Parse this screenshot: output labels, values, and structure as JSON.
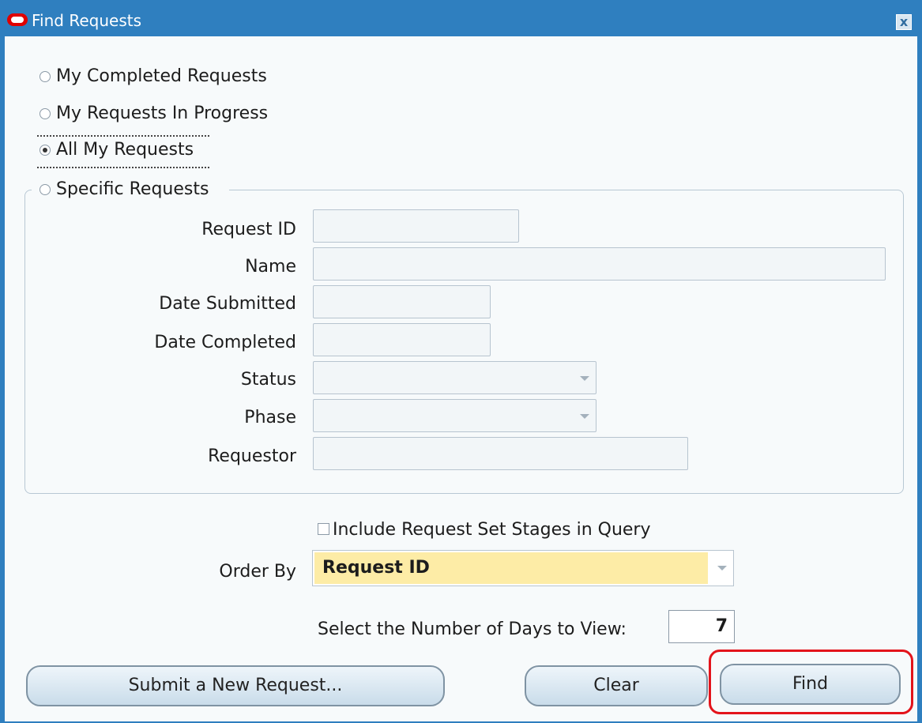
{
  "window": {
    "title": "Find Requests",
    "close_label": "x"
  },
  "request_scope": {
    "options": [
      {
        "label": "My Completed Requests",
        "selected": false
      },
      {
        "label": "My Requests In Progress",
        "selected": false
      },
      {
        "label": "All My Requests",
        "selected": true
      },
      {
        "label": "Specific Requests",
        "selected": false
      }
    ]
  },
  "specific_requests": {
    "request_id": {
      "label": "Request ID",
      "value": ""
    },
    "name": {
      "label": "Name",
      "value": ""
    },
    "date_submitted": {
      "label": "Date Submitted",
      "value": ""
    },
    "date_completed": {
      "label": "Date Completed",
      "value": ""
    },
    "status": {
      "label": "Status",
      "value": ""
    },
    "phase": {
      "label": "Phase",
      "value": ""
    },
    "requestor": {
      "label": "Requestor",
      "value": ""
    }
  },
  "include_stages": {
    "label": "Include Request Set Stages in Query",
    "checked": false
  },
  "order_by": {
    "label": "Order By",
    "value": "Request ID"
  },
  "days_to_view": {
    "label": "Select the Number of Days to View:",
    "value": "7"
  },
  "buttons": {
    "submit_new": "Submit a New Request...",
    "clear": "Clear",
    "find": "Find"
  },
  "colors": {
    "titlebar": "#2f7fbf",
    "highlight": "#e3141b",
    "orderby_bg": "#fdeca6"
  }
}
